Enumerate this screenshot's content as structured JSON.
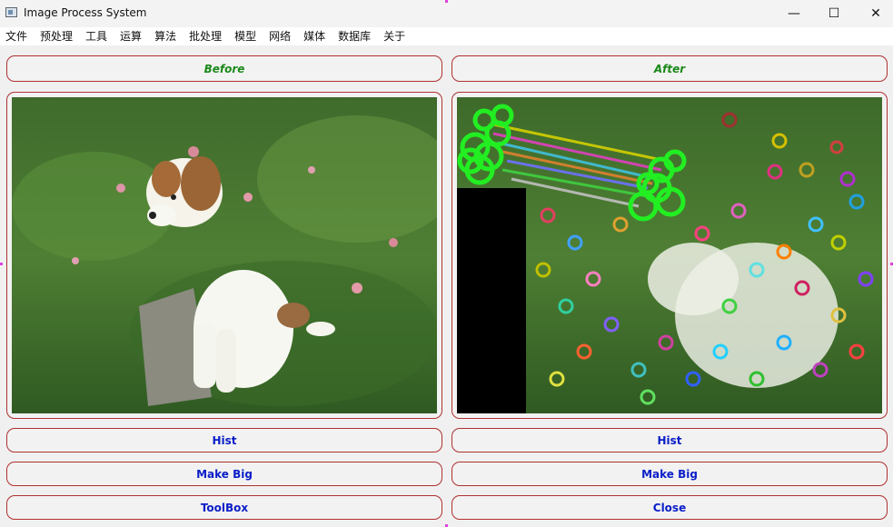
{
  "window": {
    "title": "Image Process System",
    "minimize_glyph": "—",
    "maximize_glyph": "☐",
    "close_glyph": "✕"
  },
  "menu": [
    "文件",
    "预处理",
    "工具",
    "运算",
    "算法",
    "批处理",
    "模型",
    "网络",
    "媒体",
    "数据库",
    "关于"
  ],
  "left_panel": {
    "header": "Before",
    "image_icon": "puppy-photo",
    "buttons": {
      "hist": "Hist",
      "make_big": "Make Big",
      "third": "ToolBox"
    }
  },
  "right_panel": {
    "header": "After",
    "image_icon": "puppy-feature-match-photo",
    "buttons": {
      "hist": "Hist",
      "make_big": "Make Big",
      "third": "Close"
    }
  },
  "colors": {
    "header_text": "#1a8a1a",
    "button_text": "#0a1ec8",
    "border": "#b03030"
  }
}
